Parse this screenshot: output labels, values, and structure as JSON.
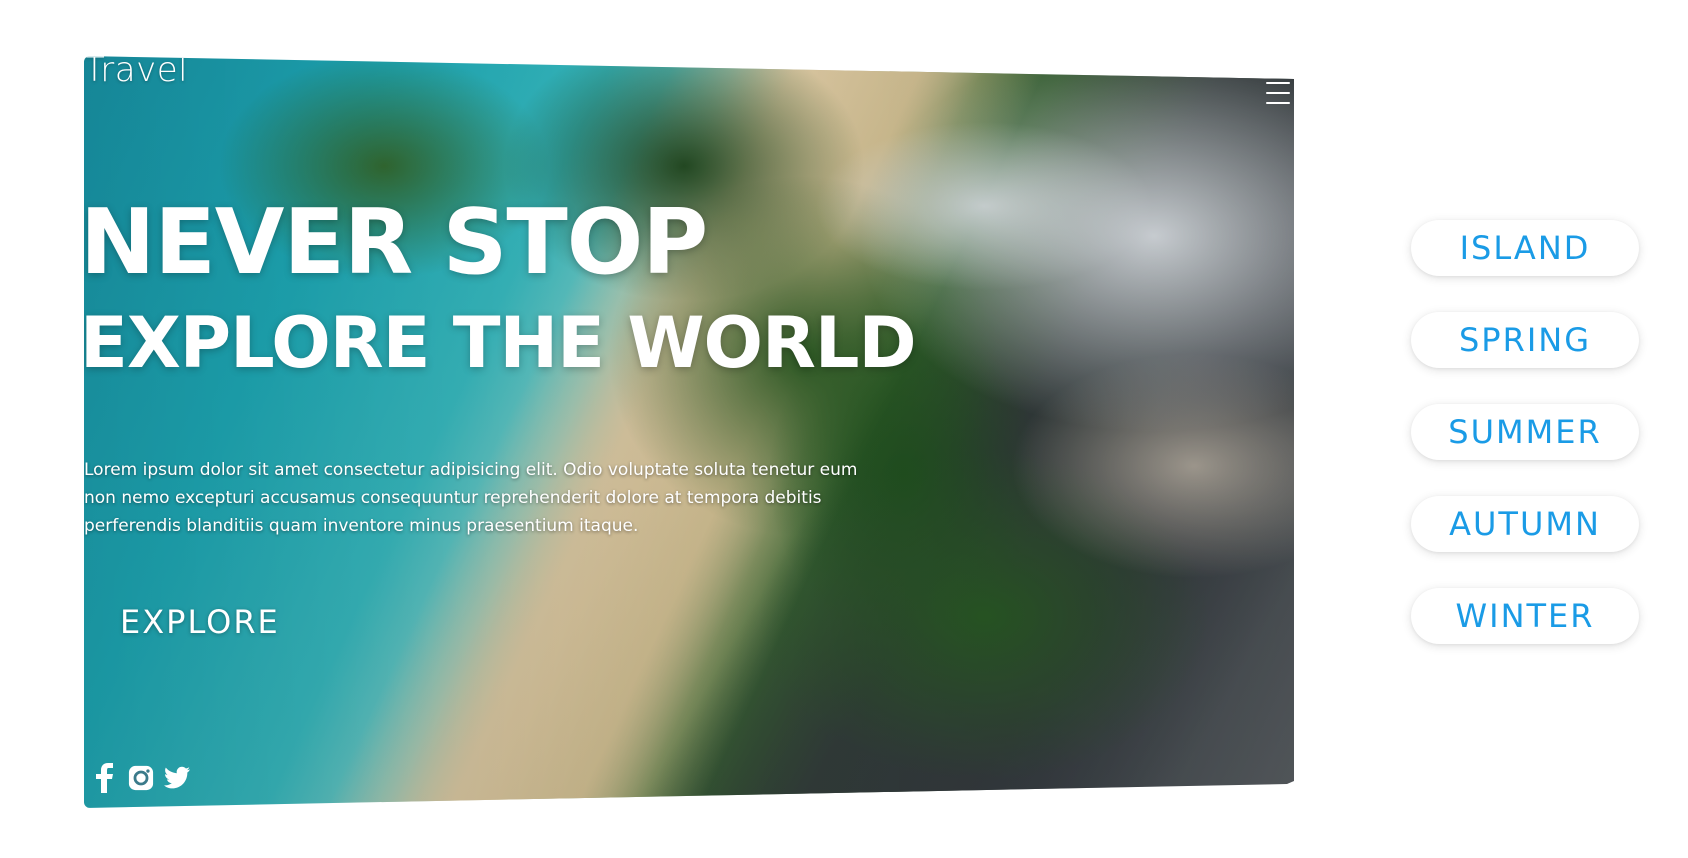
{
  "header": {
    "logo_text": "Travel",
    "menu_icon": "hamburger-menu-icon"
  },
  "hero": {
    "headline_line1": "NEVER STOP",
    "headline_line2": "EXPLORE THE WORLD",
    "body": "Lorem ipsum dolor sit amet consectetur adipisicing elit. Odio voluptate soluta tenetur eum non nemo excepturi accusamus consequuntur reprehenderit dolore at tempora debitis perferendis blanditiis quam inventore minus praesentium itaque.",
    "cta_label": "EXPLORE"
  },
  "socials": [
    {
      "icon": "facebook-icon"
    },
    {
      "icon": "instagram-icon"
    },
    {
      "icon": "twitter-icon"
    }
  ],
  "seasons": {
    "items": [
      {
        "label": "ISLAND"
      },
      {
        "label": "SPRING"
      },
      {
        "label": "SUMMER"
      },
      {
        "label": "AUTUMN"
      },
      {
        "label": "WINTER"
      }
    ]
  },
  "colors": {
    "accent": "#1a9be6",
    "text_on_image": "#ffffff",
    "background": "#ffffff"
  }
}
